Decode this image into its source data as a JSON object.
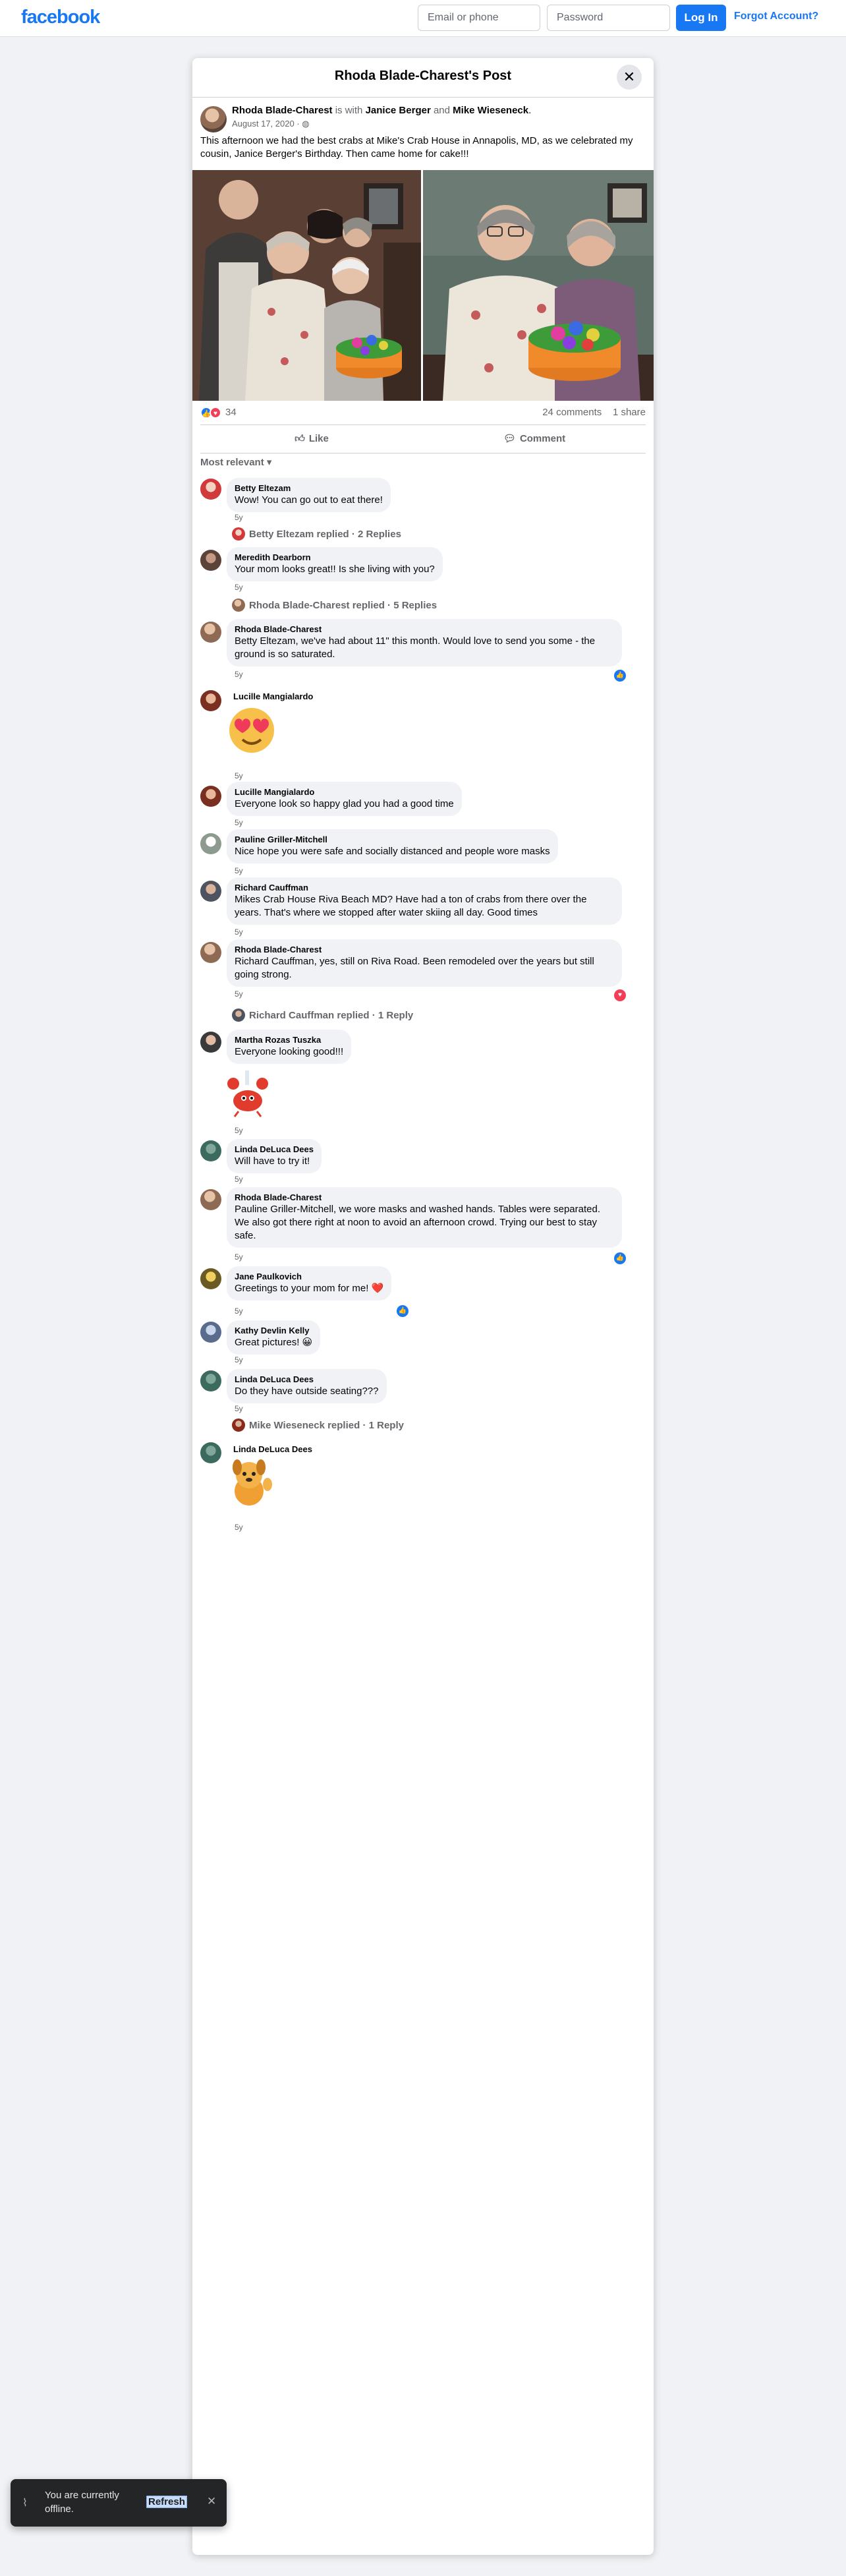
{
  "topbar": {
    "logo": "facebook",
    "email_placeholder": "Email or phone",
    "password_placeholder": "Password",
    "login_label": "Log In",
    "forgot_label": "Forgot Account?"
  },
  "modal": {
    "title": "Rhoda Blade-Charest's Post",
    "close_icon": "close-icon"
  },
  "post": {
    "author": "Rhoda Blade-Charest",
    "with_text": "is with",
    "tagged_1": "Janice Berger",
    "and_text": "and",
    "tagged_2": "Mike Wieseneck",
    "date": "August 17, 2020",
    "privacy_icon": "globe-icon",
    "text": "This afternoon we had the best crabs at Mike's Crab House in Annapolis, MD, as we celebrated my cousin, Janice Berger's Birthday.  Then came home for cake!!!",
    "reaction_count": "34",
    "comments_count": "24 comments",
    "shares_count": "1 share",
    "like_label": "Like",
    "comment_label": "Comment",
    "sort_label": "Most relevant"
  },
  "comments": [
    {
      "name": "Betty Eltezam",
      "text": "Wow! You can go out to eat there!",
      "time": "5y"
    },
    {
      "reply_line": "Betty Eltezam replied · 2 Replies"
    },
    {
      "name": "Meredith Dearborn",
      "text": "Your mom looks great!! Is she living with you?",
      "time": "5y"
    },
    {
      "reply_line": "Rhoda Blade-Charest replied · 5 Replies"
    },
    {
      "name": "Rhoda Blade-Charest",
      "text": "Betty Eltezam, we've had about 11\" this month. Would love to send you some - the ground is so saturated.",
      "time": "5y"
    },
    {
      "name": "Lucille Mangialardo",
      "sticker": "heart-eyes-sticker",
      "time": "5y"
    },
    {
      "name": "Lucille Mangialardo",
      "text": "Everyone look so happy glad you had a good time",
      "time": "5y"
    },
    {
      "name": "Pauline Griller-Mitchell",
      "text": "Nice hope you were safe and socially distanced and people wore masks",
      "time": "5y"
    },
    {
      "name": "Richard Cauffman",
      "text": "Mikes Crab House Riva Beach MD? Have had a ton of crabs from there over the years. That's where we stopped after water skiing all day. Good times",
      "time": "5y"
    },
    {
      "name": "Rhoda Blade-Charest",
      "text": "Richard Cauffman, yes, still on Riva Road. Been remodeled over the years but still going strong.",
      "time": "5y"
    },
    {
      "reply_line": "Richard Cauffman replied · 1 Reply"
    },
    {
      "name": "Martha Rozas Tuszka",
      "text": "Everyone looking good!!!",
      "sticker": "crab-chef-sticker",
      "time": "5y"
    },
    {
      "name": "Linda DeLuca Dees",
      "text": "Will have to try it!",
      "time": "5y"
    },
    {
      "name": "Rhoda Blade-Charest",
      "text": "Pauline Griller-Mitchell, we wore masks and washed hands. Tables were separated. We also got there right at noon to avoid an afternoon crowd. Trying our best to stay safe.",
      "time": "5y"
    },
    {
      "name": "Jane Paulkovich",
      "text": "Greetings to your mom for me! ❤️",
      "time": "5y"
    },
    {
      "name": "Kathy Devlin Kelly",
      "text": "Great pictures! 😀",
      "time": "5y"
    },
    {
      "name": "Linda DeLuca Dees",
      "text": "Do they have outside seating???",
      "time": "5y"
    },
    {
      "reply_line": "Mike Wieseneck replied · 1 Reply"
    },
    {
      "name": "Linda DeLuca Dees",
      "sticker": "waving-dog-sticker",
      "time": "5y"
    }
  ],
  "toast": {
    "text": "You are currently offline.",
    "refresh_label": "Refresh",
    "icon": "wifi-off-icon"
  },
  "colors": {
    "brand": "#1877f2",
    "like": "#1877f2",
    "love": "#f33e58"
  }
}
